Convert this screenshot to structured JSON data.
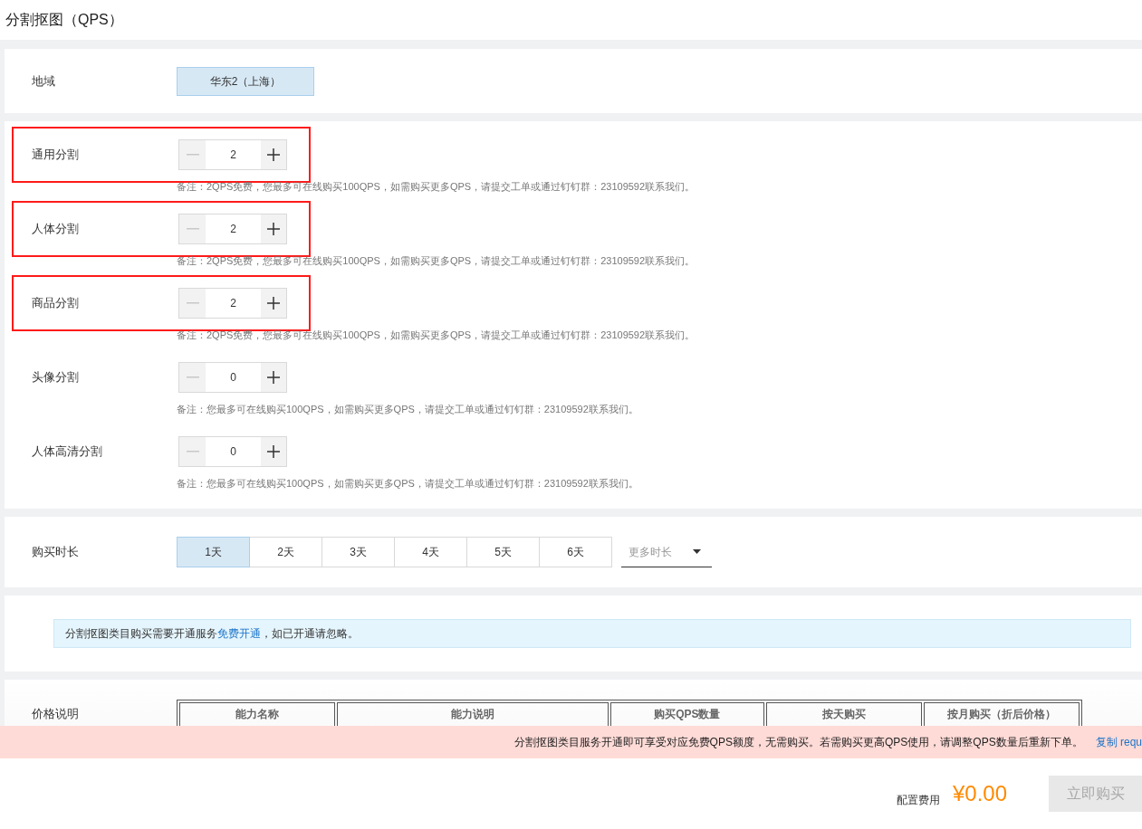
{
  "page_title": "分割抠图（QPS）",
  "region": {
    "label": "地域",
    "options": [
      {
        "label": "华东2（上海）",
        "selected": true
      }
    ]
  },
  "segments": [
    {
      "label": "通用分割",
      "value": "2",
      "note": "备注：2QPS免费，您最多可在线购买100QPS，如需购买更多QPS，请提交工单或通过钉钉群：23109592联系我们。",
      "highlighted": true
    },
    {
      "label": "人体分割",
      "value": "2",
      "note": "备注：2QPS免费，您最多可在线购买100QPS，如需购买更多QPS，请提交工单或通过钉钉群：23109592联系我们。",
      "highlighted": true
    },
    {
      "label": "商品分割",
      "value": "2",
      "note": "备注：2QPS免费，您最多可在线购买100QPS，如需购买更多QPS，请提交工单或通过钉钉群：23109592联系我们。",
      "highlighted": true
    },
    {
      "label": "头像分割",
      "value": "0",
      "note": "备注：您最多可在线购买100QPS，如需购买更多QPS，请提交工单或通过钉钉群：23109592联系我们。",
      "highlighted": false
    },
    {
      "label": "人体高清分割",
      "value": "0",
      "note": "备注：您最多可在线购买100QPS，如需购买更多QPS，请提交工单或通过钉钉群：23109592联系我们。",
      "highlighted": false
    }
  ],
  "duration": {
    "label": "购买时长",
    "options": [
      {
        "label": "1天",
        "selected": true
      },
      {
        "label": "2天",
        "selected": false
      },
      {
        "label": "3天",
        "selected": false
      },
      {
        "label": "4天",
        "selected": false
      },
      {
        "label": "5天",
        "selected": false
      },
      {
        "label": "6天",
        "selected": false
      }
    ],
    "more_placeholder": "更多时长"
  },
  "info": {
    "text_before": "分割抠图类目购买需要开通服务",
    "link": "免费开通",
    "text_after": "，如已开通请忽略。"
  },
  "pricing": {
    "label": "价格说明",
    "columns": [
      "能力名称",
      "能力说明",
      "购买QPS数量",
      "按天购买",
      "按月购买（折后价格）"
    ]
  },
  "banner": {
    "text": "分割抠图类目服务开通即可享受对应免费QPS额度，无需购买。若需购买更高QPS使用，请调整QPS数量后重新下单。",
    "link": "复制 requ"
  },
  "footer": {
    "fee_label": "配置费用",
    "price": "¥0.00",
    "buy_button": "立即购买"
  }
}
